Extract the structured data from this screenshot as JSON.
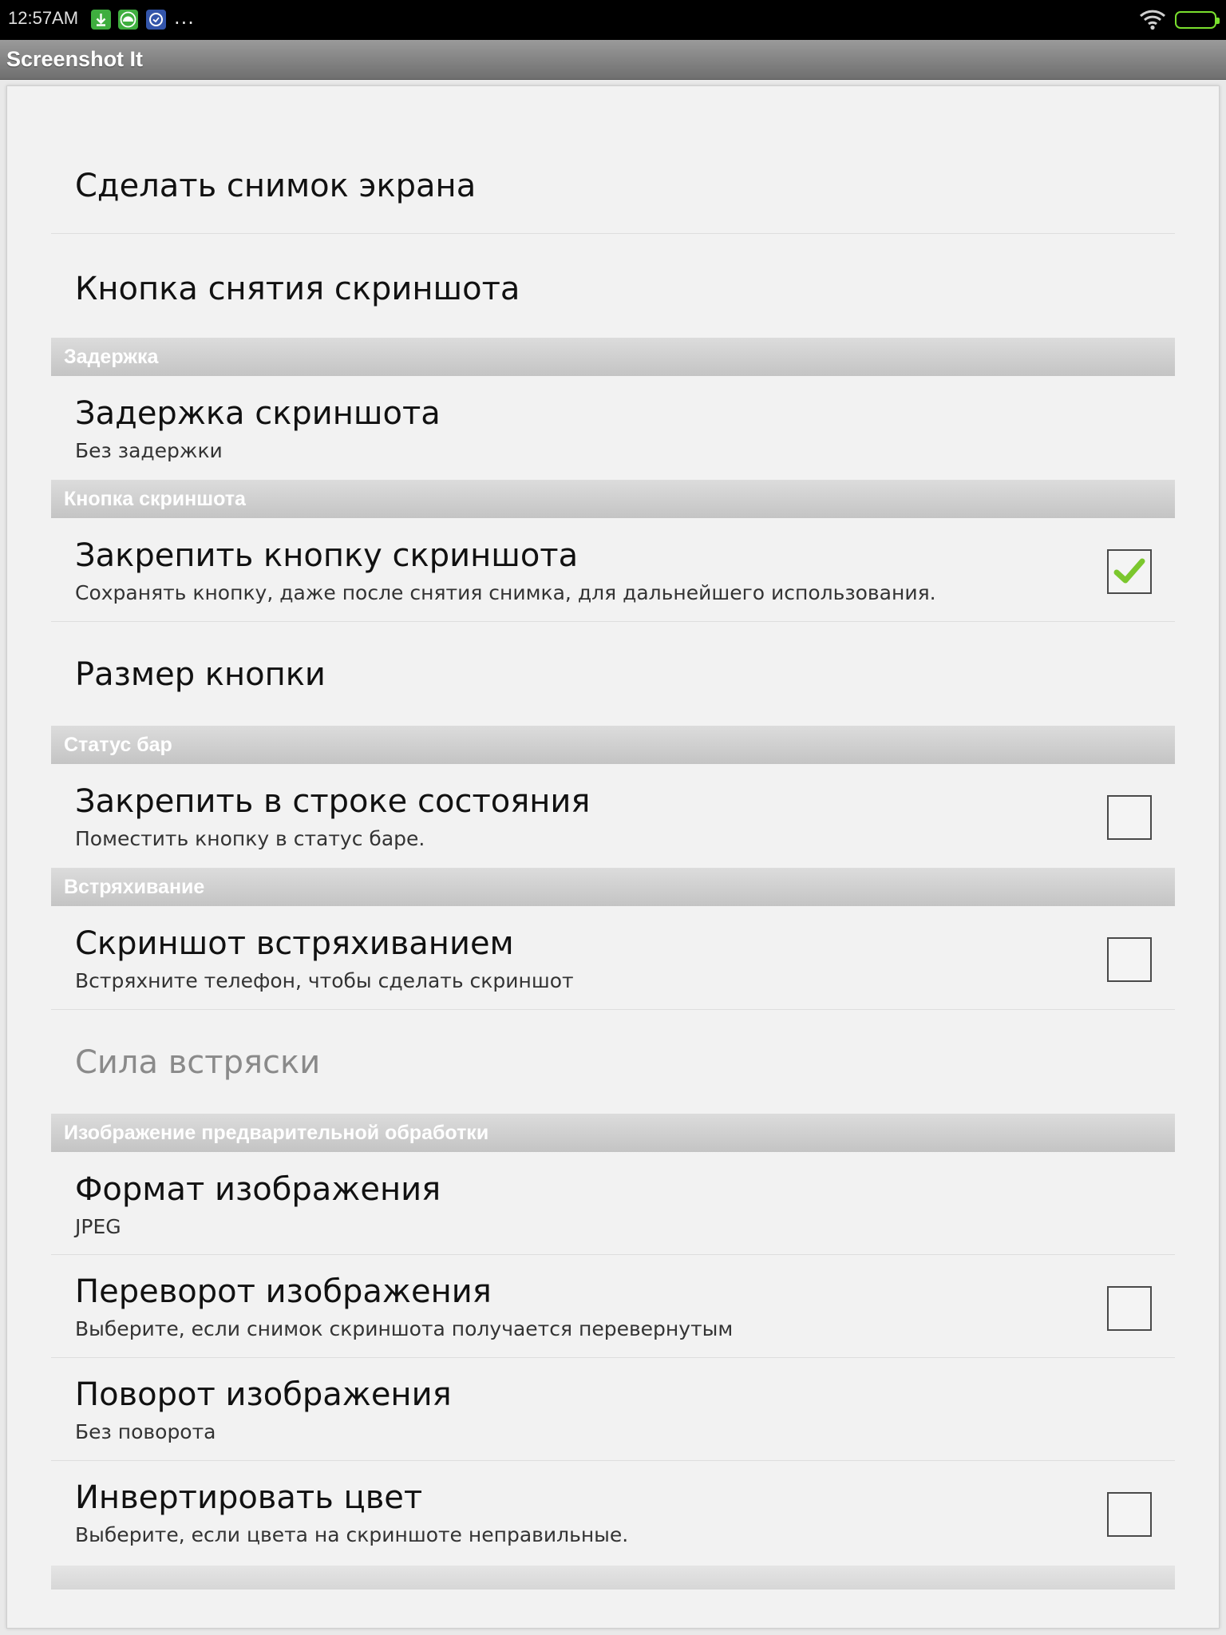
{
  "status_bar": {
    "time": "12:57AM",
    "more": "...",
    "icons": [
      "download-icon",
      "android-app-icon",
      "browser-app-icon",
      "wifi-icon",
      "battery-icon"
    ],
    "battery_color": "#7adf2e"
  },
  "action_bar": {
    "title": "Screenshot It"
  },
  "prefs": {
    "take_screenshot": {
      "title": "Сделать снимок экрана"
    },
    "screenshot_button": {
      "title": "Кнопка снятия скриншота"
    },
    "cat_delay": "Задержка",
    "delay": {
      "title": "Задержка скриншота",
      "summary": "Без задержки"
    },
    "cat_button": "Кнопка скриншота",
    "pin_button": {
      "title": "Закрепить кнопку скриншота",
      "summary": "Сохранять кнопку, даже после снятия снимка, для дальнейшего использования.",
      "checked": true
    },
    "button_size": {
      "title": "Размер кнопки"
    },
    "cat_statusbar": "Статус бар",
    "pin_statusbar": {
      "title": "Закрепить в строке состояния",
      "summary": "Поместить кнопку в статус баре.",
      "checked": false
    },
    "cat_shake": "Встряхивание",
    "shake": {
      "title": "Скриншот встряхиванием",
      "summary": "Встряхните телефон, чтобы сделать скриншот",
      "checked": false
    },
    "shake_strength": {
      "title": "Сила встряски",
      "enabled": false
    },
    "cat_image": "Изображение предварительной обработки",
    "image_format": {
      "title": "Формат изображения",
      "summary": "JPEG"
    },
    "flip": {
      "title": "Переворот изображения",
      "summary": "Выберите, если снимок скриншота получается перевернутым",
      "checked": false
    },
    "rotate": {
      "title": "Поворот изображения",
      "summary": "Без поворота"
    },
    "invert": {
      "title": "Инвертировать цвет",
      "summary": "Выберите, если цвета на скриншоте неправильные.",
      "checked": false
    }
  },
  "colors": {
    "check_green": "#7bc72d",
    "category_text": "#ffffff"
  }
}
